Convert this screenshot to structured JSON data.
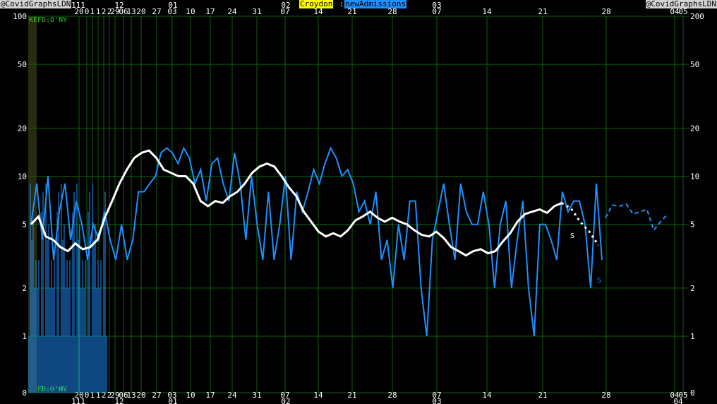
{
  "header": {
    "credit_left": "@CovidGraphsLDN",
    "credit_right": "@CovidGraphsLDN",
    "area": "Croydon",
    "separator": ":",
    "metric": "newAdmissions"
  },
  "colors": {
    "background": "#000000",
    "grid": "#0e5f0e",
    "daily": "#1e90ff",
    "average": "#ffffff",
    "area_badge": "#ffff00",
    "metric_badge": "#1e90ff",
    "credit_badge": "#d3d3d3",
    "corner_text": "#22cc22"
  },
  "chart_data": {
    "type": "line",
    "title": "Croydon:newAdmissions",
    "yscale": "log",
    "ylim": [
      0,
      100
    ],
    "y_ticks": [
      "0",
      "1",
      "2",
      "5",
      "10",
      "20",
      "50",
      "100"
    ],
    "y_ticks_right": [
      "0",
      "1",
      "2",
      "5",
      "10",
      "20",
      "50",
      "200"
    ],
    "x_ticks_day": [
      "20",
      "0",
      "1",
      "1",
      "2",
      "2",
      "29",
      "06",
      "13",
      "20",
      "27",
      "03",
      "10",
      "17",
      "24",
      "31",
      "07",
      "14",
      "21",
      "28",
      "07",
      "14",
      "21",
      "28",
      "04",
      "05"
    ],
    "x_ticks_month": [
      "111",
      "12",
      "01",
      "02",
      "03",
      "04"
    ],
    "corner_label_top": "KEFD:O'NY",
    "corner_label_bottom": "FD:O'NY",
    "x_annotations": [
      "S",
      "S"
    ],
    "series": [
      {
        "role": "daily",
        "values": [
          5,
          9,
          4,
          10,
          3,
          6,
          9,
          4,
          7,
          5,
          3,
          5,
          4,
          6,
          4,
          3,
          5,
          3,
          4,
          8,
          8,
          9,
          10,
          14,
          15,
          14,
          12,
          15,
          13,
          9,
          11,
          7,
          12,
          13,
          9,
          7,
          14,
          9,
          4,
          10,
          5,
          3,
          8,
          3,
          5,
          10,
          3,
          8,
          6,
          8,
          11,
          9,
          12,
          15,
          13,
          10,
          11,
          9,
          6,
          7,
          5,
          8,
          3,
          4,
          2,
          5,
          3,
          7,
          7,
          2,
          1,
          4,
          6,
          9,
          5,
          3,
          9,
          6,
          5,
          5,
          8,
          5,
          2,
          5,
          7,
          2,
          4,
          7,
          2,
          1,
          5,
          5,
          4,
          3,
          8,
          6,
          7,
          7,
          5,
          2,
          9,
          3
        ]
      },
      {
        "role": "rolling-average",
        "values": [
          5,
          5.6,
          4.2,
          4,
          3.6,
          3.4,
          3.8,
          3.5,
          3.6,
          4,
          5.5,
          7,
          9,
          11,
          13,
          14,
          14.5,
          13,
          11,
          10.5,
          10,
          10,
          9,
          7,
          6.5,
          7,
          6.8,
          7.5,
          8,
          9,
          10.5,
          11.5,
          12,
          11.5,
          10,
          8.5,
          7.5,
          6,
          5.2,
          4.5,
          4.2,
          4.4,
          4.2,
          4.6,
          5.3,
          5.6,
          6,
          5.5,
          5.2,
          5.5,
          5.2,
          5,
          4.6,
          4.3,
          4.2,
          4.5,
          4.1,
          3.6,
          3.4,
          3.2,
          3.4,
          3.5,
          3.3,
          3.4,
          3.9,
          4.4,
          5.2,
          5.8,
          6,
          6.2,
          5.9,
          6.5,
          6.8
        ]
      },
      {
        "role": "projection",
        "values": [
          6.8,
          6.3,
          5.2,
          4.5,
          3.7
        ]
      },
      {
        "role": "daily-projection",
        "values": [
          5.5,
          6.6,
          6.5,
          6.7,
          5.8,
          6,
          6.2,
          4.6,
          5.2,
          5.8
        ]
      }
    ]
  }
}
